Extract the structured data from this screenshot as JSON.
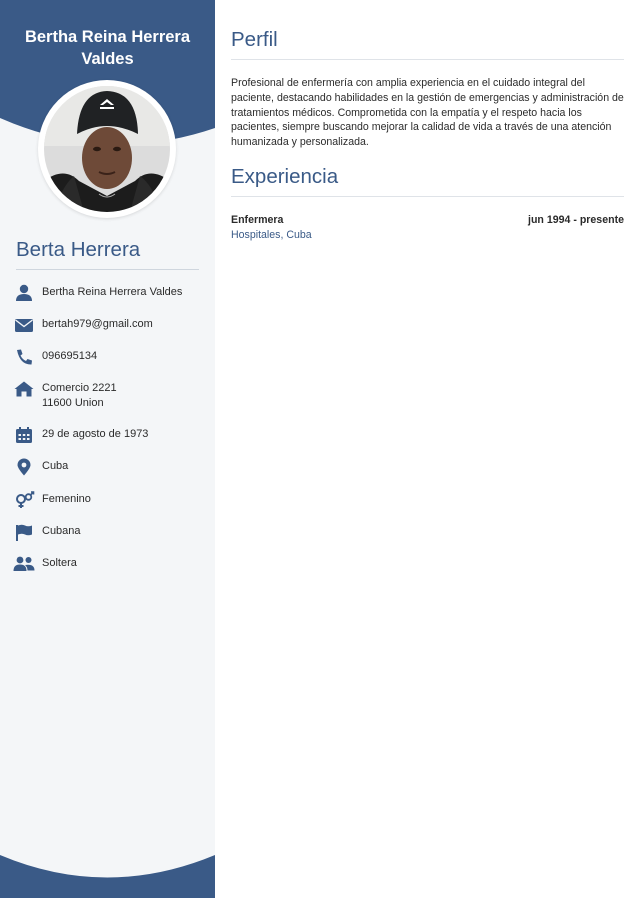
{
  "sidebar": {
    "full_name": "Bertha Reina Herrera Valdes",
    "section_heading": "Berta Herrera",
    "contacts": [
      {
        "icon": "user-icon",
        "lines": [
          "Bertha Reina Herrera Valdes"
        ]
      },
      {
        "icon": "envelope-icon",
        "lines": [
          "bertah979@gmail.com"
        ]
      },
      {
        "icon": "phone-icon",
        "lines": [
          "096695134"
        ]
      },
      {
        "icon": "home-icon",
        "lines": [
          "Comercio 2221",
          "11600 Union"
        ]
      },
      {
        "icon": "calendar-icon",
        "lines": [
          "29 de agosto de 1973"
        ]
      },
      {
        "icon": "map-pin-icon",
        "lines": [
          "Cuba"
        ]
      },
      {
        "icon": "gender-icon",
        "lines": [
          "Femenino"
        ]
      },
      {
        "icon": "flag-icon",
        "lines": [
          "Cubana"
        ]
      },
      {
        "icon": "users-icon",
        "lines": [
          "Soltera"
        ]
      }
    ]
  },
  "main": {
    "profile": {
      "heading": "Perfil",
      "text": "Profesional de enfermería con amplia experiencia en el cuidado integral del paciente, destacando habilidades en la gestión de emergencias y administración de tratamientos médicos. Comprometida con la empatía y el respeto hacia los pacientes, siempre buscando mejorar la calidad de vida a través de una atención humanizada y personalizada."
    },
    "experience": {
      "heading": "Experiencia",
      "items": [
        {
          "title": "Enfermera",
          "dates": "jun 1994 - presente",
          "company": "Hospitales, Cuba"
        }
      ]
    }
  },
  "colors": {
    "accent": "#3a5a87",
    "sidebar_bg": "#f4f6f8",
    "text": "#2b2b2b"
  }
}
